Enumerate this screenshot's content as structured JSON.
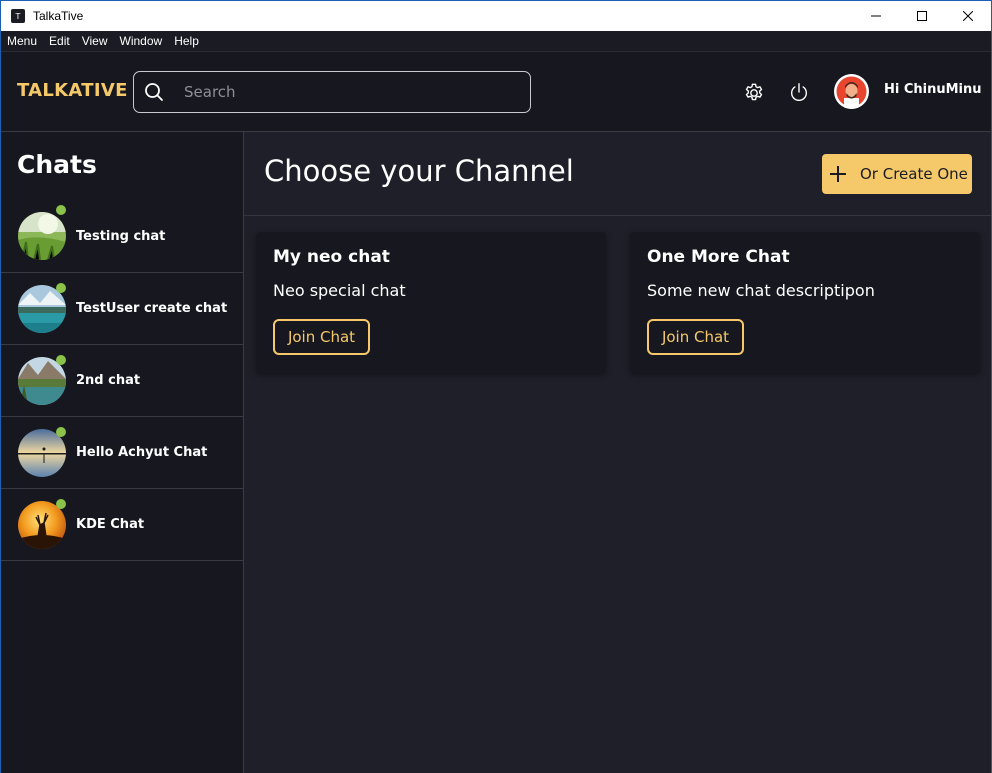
{
  "window": {
    "title": "TalkaTive",
    "app_icon": "app-logo-icon",
    "controls": [
      "minimize-icon",
      "maximize-icon",
      "close-icon"
    ]
  },
  "menubar": {
    "items": [
      "Menu",
      "Edit",
      "View",
      "Window",
      "Help"
    ]
  },
  "header": {
    "logo": "TALKATIVE",
    "search": {
      "placeholder": "Search",
      "value": ""
    },
    "settings_icon": "gear-icon",
    "power_icon": "power-icon",
    "user_greeting": "Hi ChinuMinu"
  },
  "sidebar": {
    "title": "Chats",
    "chats": [
      {
        "name": "Testing chat",
        "online": true,
        "avatar": "meadow"
      },
      {
        "name": "TestUser create chat",
        "online": true,
        "avatar": "lake"
      },
      {
        "name": "2nd chat",
        "online": true,
        "avatar": "mountain-lake"
      },
      {
        "name": "Hello Achyut Chat",
        "online": true,
        "avatar": "sunset-pier"
      },
      {
        "name": "KDE Chat",
        "online": true,
        "avatar": "deer-sunset"
      }
    ]
  },
  "main": {
    "title": "Choose your Channel",
    "create_button": "Or Create One",
    "channels": [
      {
        "title": "My neo chat",
        "description": "Neo special chat",
        "button": "Join Chat"
      },
      {
        "title": "One More Chat",
        "description": "Some new chat descriptipon",
        "button": "Join Chat"
      }
    ]
  },
  "colors": {
    "accent": "#f5c96a",
    "background": "#1f1f29",
    "sidebar": "#17181f",
    "online": "#8bc34a"
  }
}
